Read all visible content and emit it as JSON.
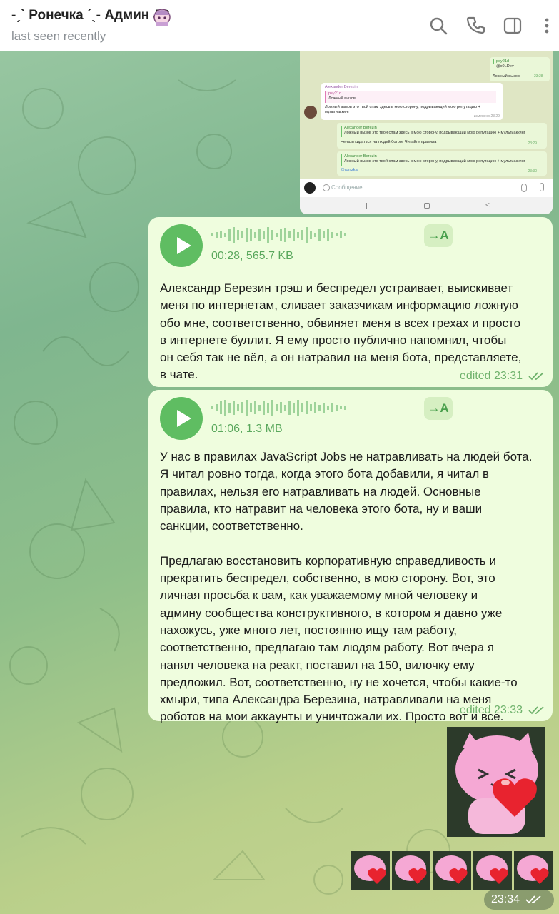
{
  "header": {
    "title": "-ˏˋ Ронечка ˊˎ- Админ JS",
    "status": "last seen recently",
    "icons": [
      "search-icon",
      "phone-icon",
      "sidebar-icon",
      "more-icon"
    ]
  },
  "screenshot": {
    "top_sender": "psy21d",
    "top_handle": "@x0LDev",
    "top_text": "Ложный вызов",
    "top_time": "23:28",
    "reply_sender": "Alexander Berezin",
    "reply_quote_name": "psy21d",
    "reply_quote_text": "Ложный вызов",
    "reply_text": "Ложный вызов это твой спам здесь в мою сторону, подрывающий мою репутацию + мультиаккинг",
    "reply_time": "изменено 23:29",
    "q1_name": "Alexander Berezin",
    "q1_text": "Ложный вызов это твой спам здесь в мою сторону, подрывающий мою репутацию + мультиаккинг",
    "q1_reply": "Нельзя кидаться на людей ботом. Читайте правила",
    "q1_time": "23:29",
    "q2_name": "Alexander Berezin",
    "q2_text": "Ложный вызов это твой спам здесь в мою сторону, подрывающий мою репутацию + мультиаккинг",
    "q2_reply": "@ronizka",
    "q2_time": "23:30",
    "input_placeholder": "Сообщение"
  },
  "messages": [
    {
      "duration": "00:28, 565.7 KB",
      "translate_label": "→A",
      "text": "Александр Березин трэш и беспредел устраивает, выискивает\nменя по интернетам, сливает заказчикам информацию ложную\nобо мне, соответственно, обвиняет меня в всех грехах и просто\nв интернете буллит. Я ему просто публично напомнил, чтобы\nон себя так не вёл, а он натравил на меня бота, представляете,\nв чате.",
      "meta": "edited 23:31"
    },
    {
      "duration": "01:06, 1.3 MB",
      "translate_label": "→A",
      "text": "У нас в правилах JavaScript Jobs не натравливать на людей бота.\nЯ читал ровно тогда, когда этого бота добавили, я читал в\nправилах, нельзя его натравливать на людей. Основные\nправила, кто натравит на человека этого бота, ну и ваши\nсанкции, соответственно.\n\nПредлагаю восстановить корпоративную справедливость и\nпрекратить беспредел, собственно, в мою сторону. Вот, это\nличная просьба к вам, как уважаемому мной человеку и\nадмину сообщества конструктивного, в котором я давно уже\nнахожусь, уже много лет, постоянно ищу там работу,\nсоответственно, предлагаю там людям работу. Вот вчера я\nнанял человека на реакт, поставил на 150, вилочку ему\nпредложил. Вот, соответственно, ну не хочется, чтобы какие-то\nхмыри, типа Александра Березина, натравливали на меня\nроботов на мои аккаунты и уничтожали их. Просто вот и всё.",
      "meta": "edited 23:33"
    }
  ],
  "stickers": {
    "big": "pink-cat-heart",
    "small_count": 5
  },
  "last_time": "23:34",
  "colors": {
    "bubble": "#effdde",
    "accent": "#5fbd62",
    "meta": "#6fb26c"
  }
}
